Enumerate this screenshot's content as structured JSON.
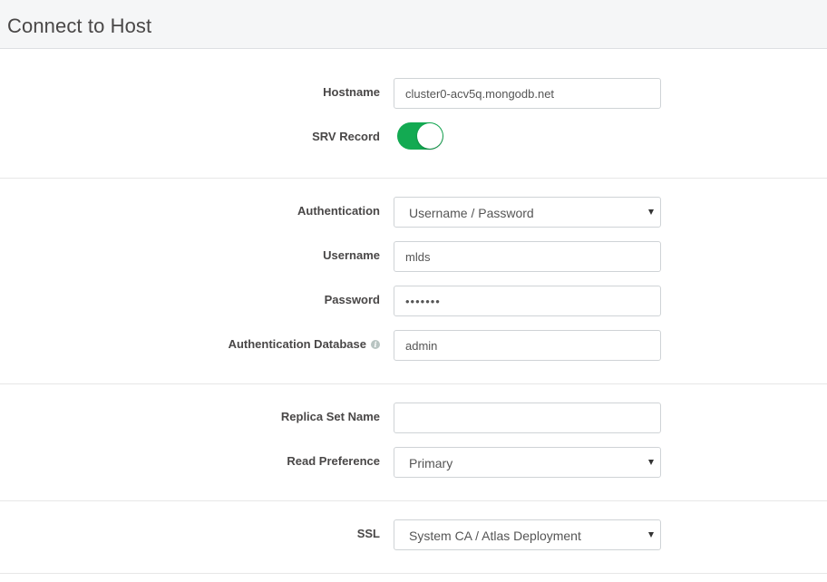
{
  "header": {
    "title": "Connect to Host"
  },
  "hostname": {
    "label": "Hostname",
    "value": "cluster0-acv5q.mongodb.net"
  },
  "srv_record": {
    "label": "SRV Record",
    "enabled": true,
    "accent": "#13aa52"
  },
  "authentication": {
    "label": "Authentication",
    "selected": "Username / Password"
  },
  "username": {
    "label": "Username",
    "value": "mlds"
  },
  "password": {
    "label": "Password",
    "value": "•••••••"
  },
  "auth_database": {
    "label": "Authentication Database",
    "icon": "info-icon",
    "value": "admin"
  },
  "replica_set": {
    "label": "Replica Set Name",
    "value": ""
  },
  "read_preference": {
    "label": "Read Preference",
    "selected": "Primary"
  },
  "ssl": {
    "label": "SSL",
    "selected": "System CA / Atlas Deployment"
  }
}
